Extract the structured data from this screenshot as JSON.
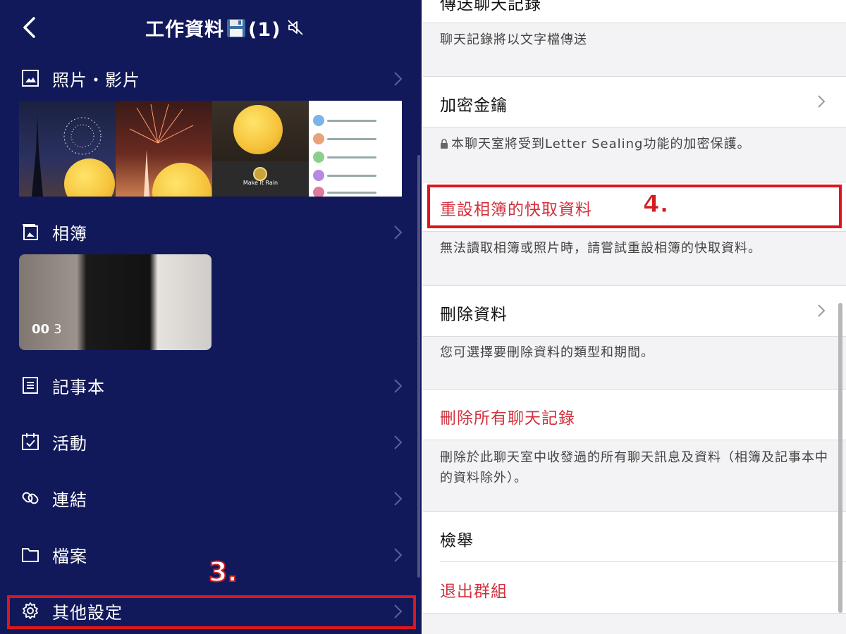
{
  "left": {
    "header": {
      "title": "工作資料",
      "count": "(1)"
    },
    "rows": [
      {
        "label": "照片・影片"
      },
      {
        "label": "相簿"
      },
      {
        "label": "記事本"
      },
      {
        "label": "活動"
      },
      {
        "label": "連結"
      },
      {
        "label": "檔案"
      },
      {
        "label": "其他設定"
      }
    ],
    "photos": {
      "thumb3_caption": "Make It Rain"
    },
    "album": {
      "count_icon": "00",
      "count": "3"
    },
    "annotation": "3."
  },
  "right": {
    "top_cut_title": "傳送聊天記錄",
    "send_desc": "聊天記錄將以文字檔傳送",
    "encryption": {
      "title": "加密金鑰",
      "desc": "本聊天室將受到Letter Sealing功能的加密保護。"
    },
    "reset_cache": {
      "title": "重設相簿的快取資料",
      "desc": "無法讀取相簿或照片時，請嘗試重設相簿的快取資料。"
    },
    "delete_data": {
      "title": "刪除資料",
      "desc": "您可選擇要刪除資料的類型和期間。"
    },
    "delete_all": {
      "title": "刪除所有聊天記錄",
      "desc": "刪除於此聊天室中收發過的所有聊天訊息及資料（相簿及記事本中的資料除外）。"
    },
    "report": {
      "title": "檢舉"
    },
    "leave": {
      "title": "退出群組"
    },
    "annotation": "4."
  },
  "colors": {
    "left_bg": "#12195a",
    "red_text": "#d2323e",
    "highlight": "#e0141c"
  }
}
